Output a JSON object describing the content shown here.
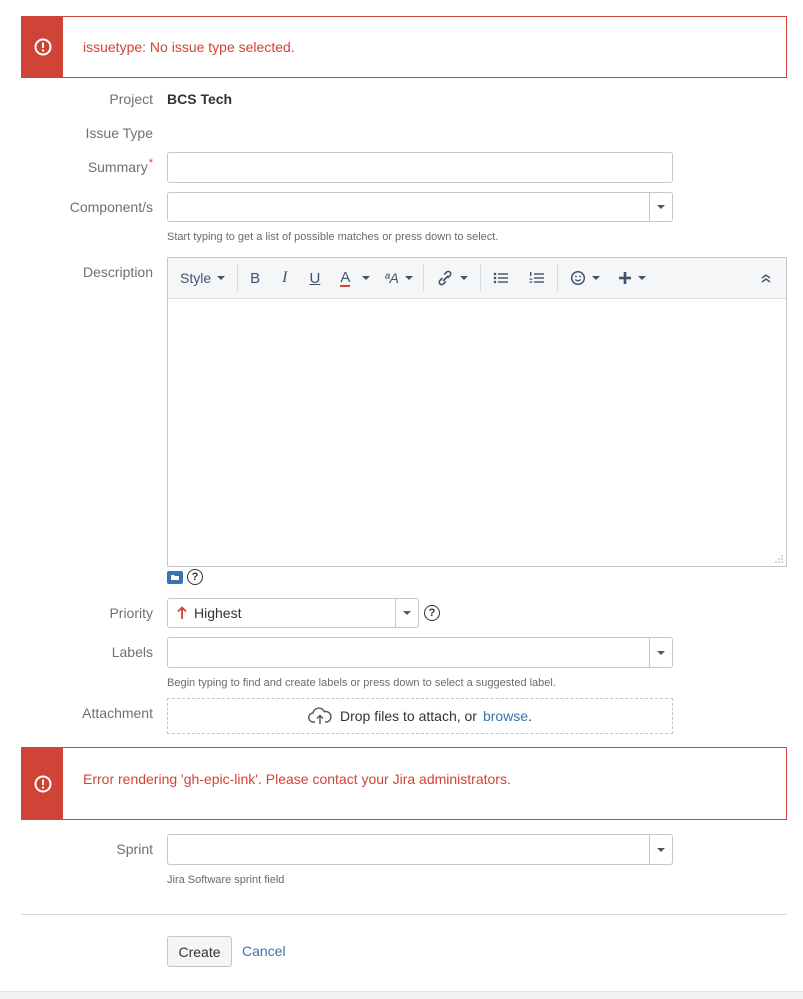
{
  "errors": {
    "top": "issuetype: No issue type selected.",
    "epic": "Error rendering 'gh-epic-link'. Please contact your Jira administrators."
  },
  "fields": {
    "project": {
      "label": "Project",
      "value": "BCS Tech"
    },
    "issue_type": {
      "label": "Issue Type"
    },
    "summary": {
      "label": "Summary",
      "required_marker": "*",
      "value": ""
    },
    "components": {
      "label": "Component/s",
      "value": "",
      "hint": "Start typing to get a list of possible matches or press down to select."
    },
    "description": {
      "label": "Description"
    },
    "priority": {
      "label": "Priority",
      "value": "Highest",
      "help": "?"
    },
    "labels": {
      "label": "Labels",
      "value": "",
      "hint": "Begin typing to find and create labels or press down to select a suggested label."
    },
    "attachment": {
      "label": "Attachment",
      "drop_text": "Drop files to attach, or",
      "browse_label": "browse",
      "browse_suffix": "."
    },
    "sprint": {
      "label": "Sprint",
      "value": "",
      "hint": "Jira Software sprint field"
    }
  },
  "toolbar": {
    "style_label": "Style",
    "bold": "B",
    "italic": "I",
    "underline": "U",
    "text_color": "A",
    "more_formatting": "ªA"
  },
  "editor_footer": {
    "help": "?"
  },
  "actions": {
    "create_label": "Create",
    "cancel_label": "Cancel"
  },
  "colors": {
    "error": "#d04437",
    "link": "#3b73af",
    "priority_highest": "#d04437"
  }
}
